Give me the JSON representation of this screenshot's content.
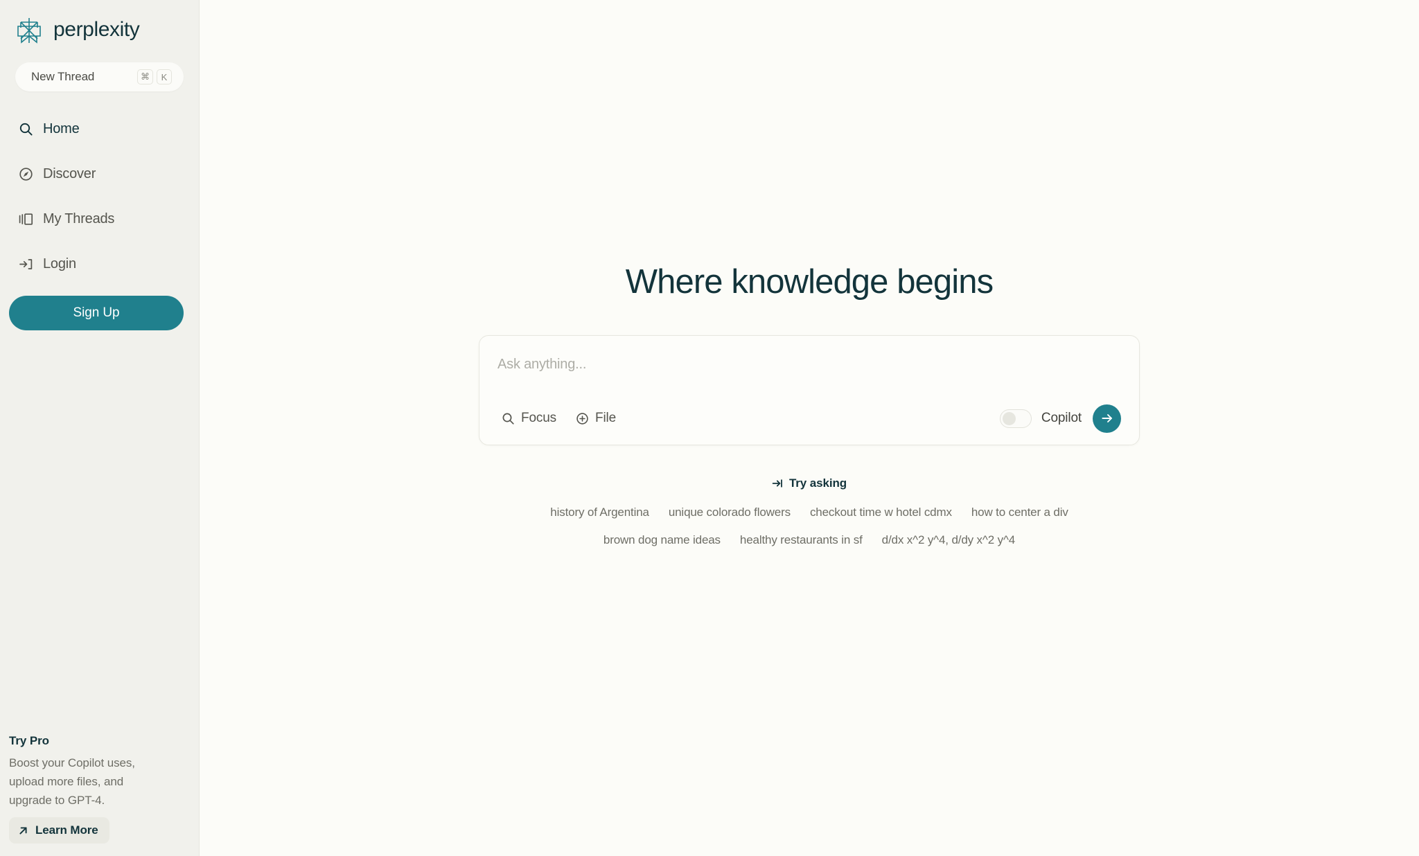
{
  "brand": {
    "name": "perplexity",
    "logo_icon": "perplexity-starburst-logo",
    "accent_color": "#20808D",
    "text_color": "#13343B"
  },
  "sidebar": {
    "new_thread": {
      "label": "New Thread",
      "keys": [
        "⌘",
        "K"
      ]
    },
    "items": [
      {
        "label": "Home",
        "icon": "search-icon",
        "active": true
      },
      {
        "label": "Discover",
        "icon": "compass-icon",
        "active": false
      },
      {
        "label": "My Threads",
        "icon": "threads-panel-icon",
        "active": false
      },
      {
        "label": "Login",
        "icon": "sign-in-icon",
        "active": false
      }
    ],
    "signup_label": "Sign Up",
    "pro": {
      "title": "Try Pro",
      "description": "Boost your Copilot uses, upload more files, and upgrade to GPT-4.",
      "learn_more_label": "Learn More",
      "learn_more_icon": "arrow-up-right-icon"
    }
  },
  "main": {
    "hero_title": "Where knowledge begins",
    "ask": {
      "placeholder": "Ask anything...",
      "value": "",
      "focus_label": "Focus",
      "focus_icon": "search-icon",
      "file_label": "File",
      "file_icon": "plus-circle-icon",
      "copilot_label": "Copilot",
      "copilot_enabled": false,
      "submit_icon": "arrow-right-icon"
    },
    "try_asking": {
      "label": "Try asking",
      "icon": "arrow-enter-icon",
      "rows": [
        [
          "history of Argentina",
          "unique colorado flowers",
          "checkout time w hotel cdmx",
          "how to center a div"
        ],
        [
          "brown dog name ideas",
          "healthy restaurants in sf",
          "d/dx x^2 y^4, d/dy x^2 y^4"
        ]
      ]
    }
  }
}
